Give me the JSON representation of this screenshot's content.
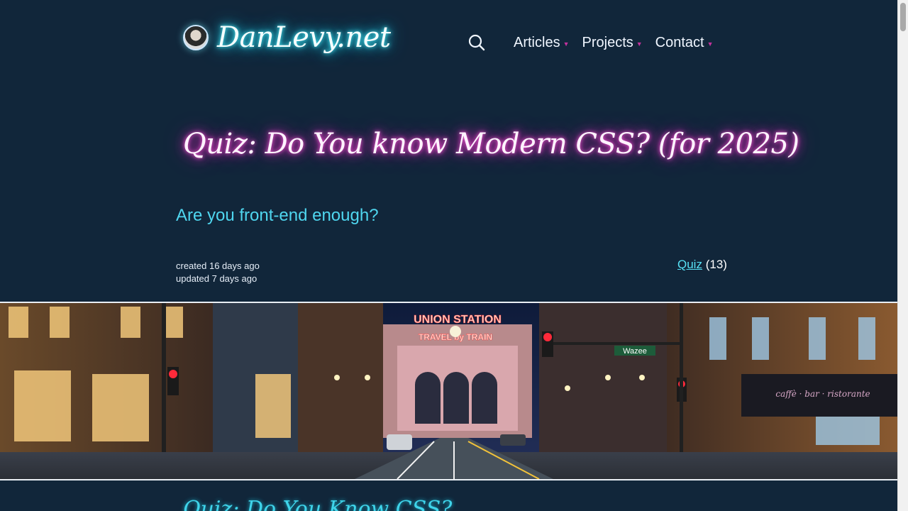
{
  "site": {
    "name": "DanLevy.net",
    "avatar_icon": "avatar-photo"
  },
  "nav": {
    "search_icon": "search-icon",
    "items": [
      {
        "label": "Articles"
      },
      {
        "label": "Projects"
      },
      {
        "label": "Contact"
      }
    ]
  },
  "article": {
    "title": "Quiz: Do You know Modern CSS? (for 2025)",
    "subtitle": "Are you front-end enough?",
    "created": "created 16 days ago",
    "updated": "updated 7 days ago",
    "tag_label": "Quiz",
    "tag_count": "(13)",
    "next_heading": "Quiz: Do You Know CSS?"
  },
  "hero": {
    "sign_line1": "UNION STATION",
    "sign_line2": "TRAVEL by TRAIN",
    "street_sign": "Wazee"
  },
  "colors": {
    "background": "#11263a",
    "brand_glow": "#23d7f2",
    "title_glow": "#e22bc2",
    "subtitle": "#4fd6ef",
    "link": "#57e1f5"
  }
}
